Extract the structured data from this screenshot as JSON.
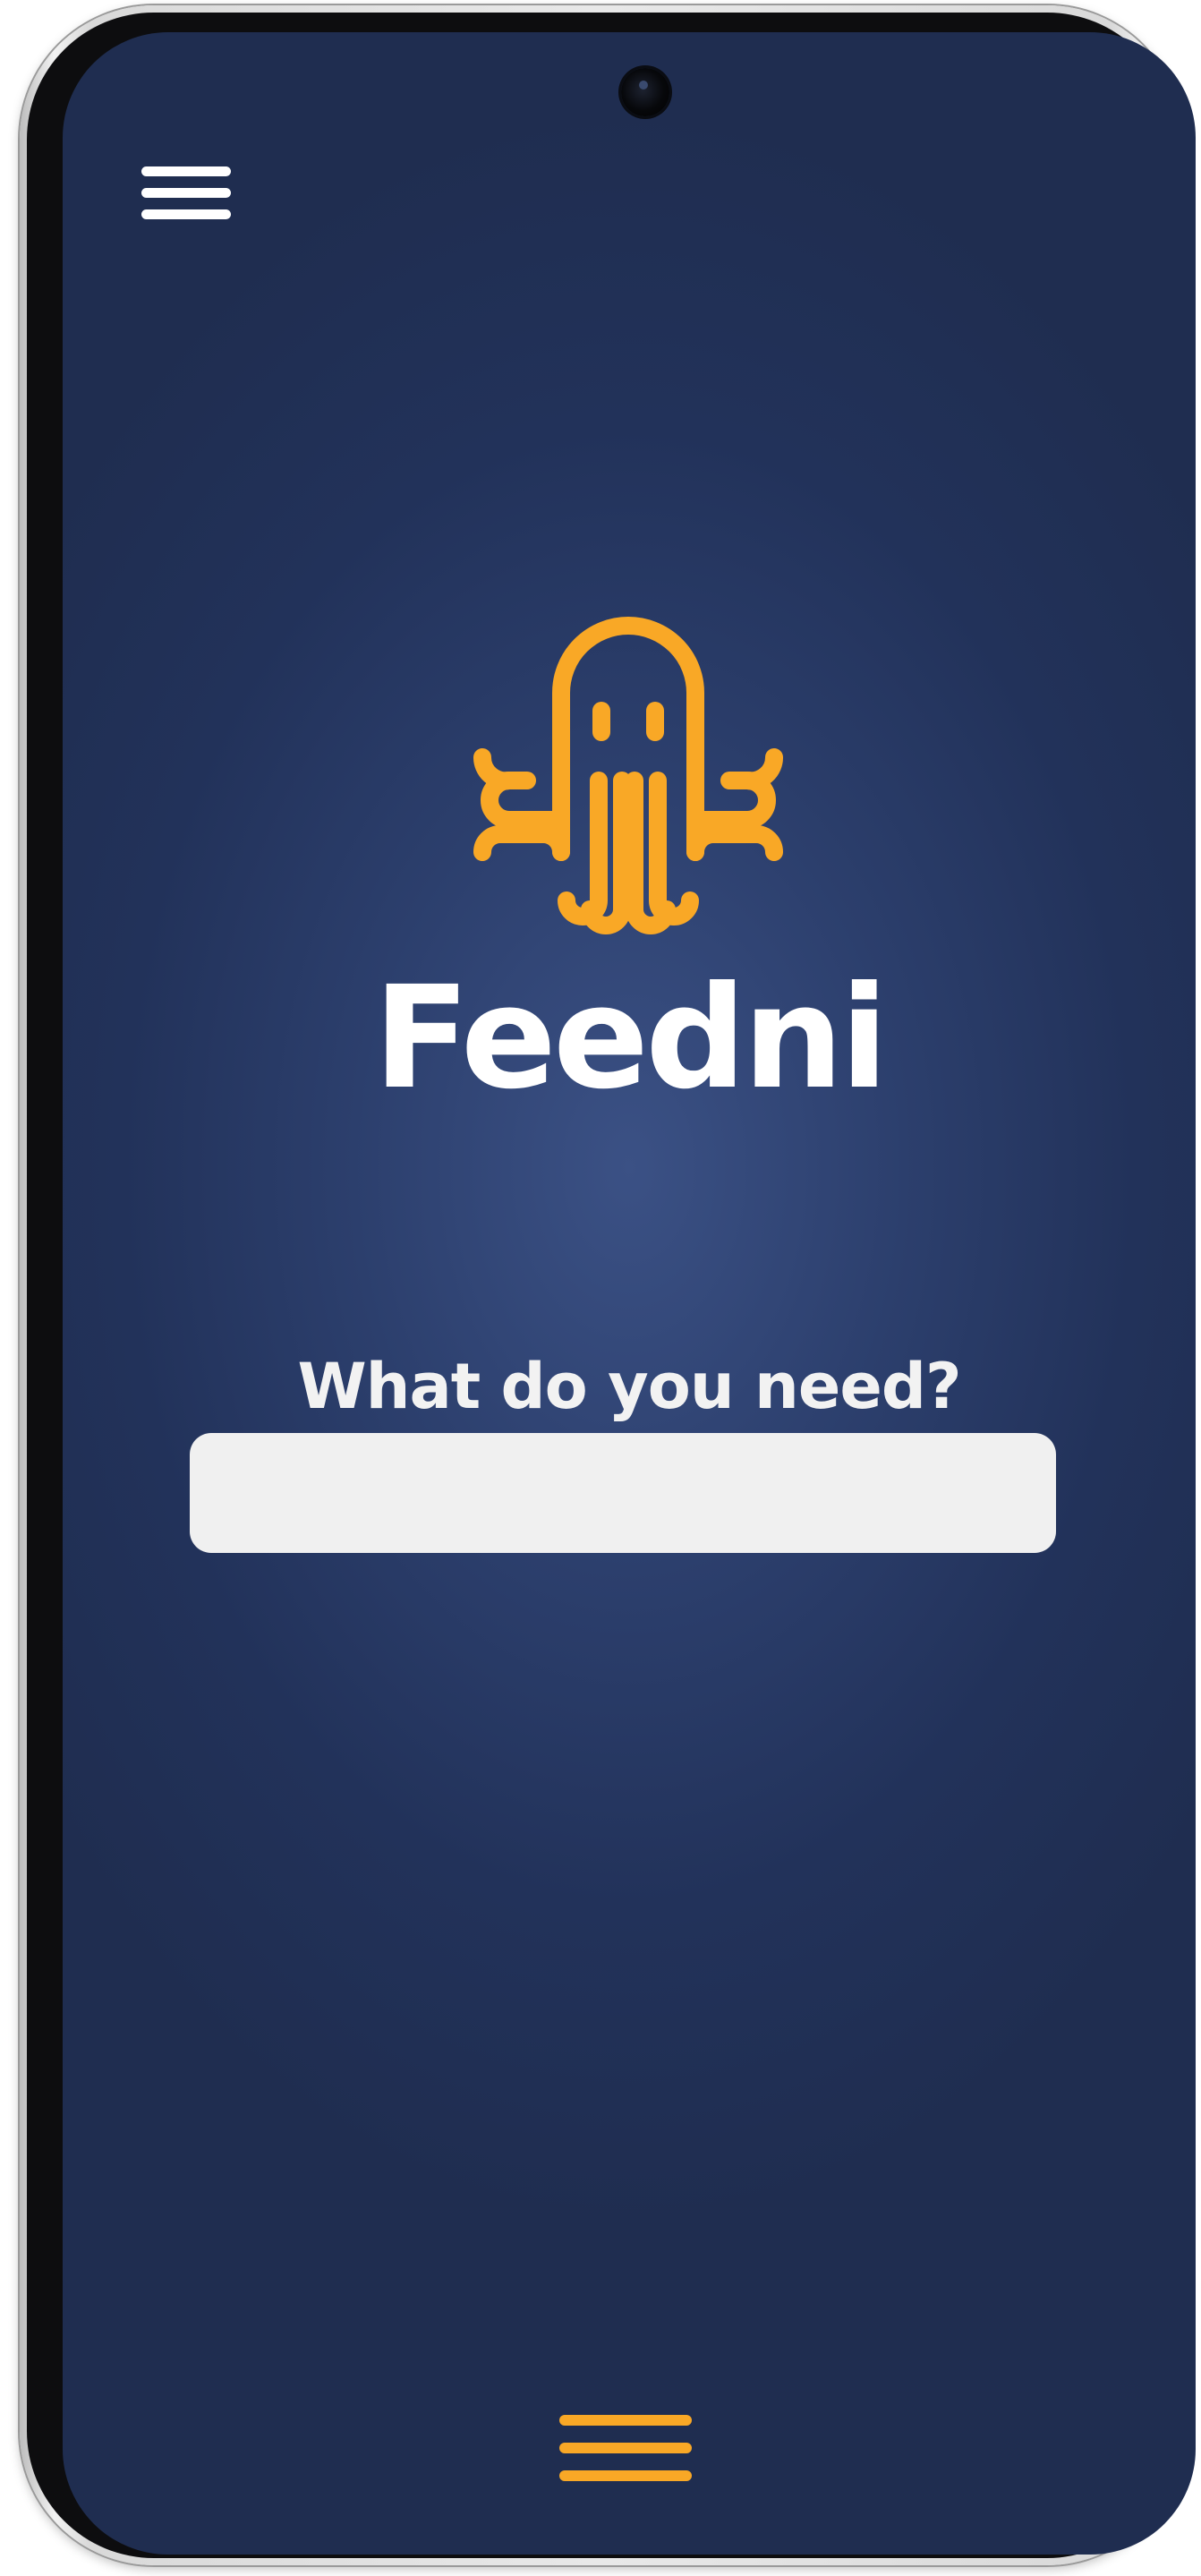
{
  "app": {
    "name": "Feedni",
    "prompt": "What do you need?"
  },
  "search": {
    "value": "",
    "placeholder": ""
  },
  "icons": {
    "top_menu": "hamburger-menu-icon",
    "logo": "octopus-logo-icon",
    "bottom_menu": "hamburger-menu-icon"
  },
  "colors": {
    "background": "#2c3f6d",
    "accent": "#f9a826",
    "text": "#ffffff",
    "input_background": "#f0f0f0"
  }
}
